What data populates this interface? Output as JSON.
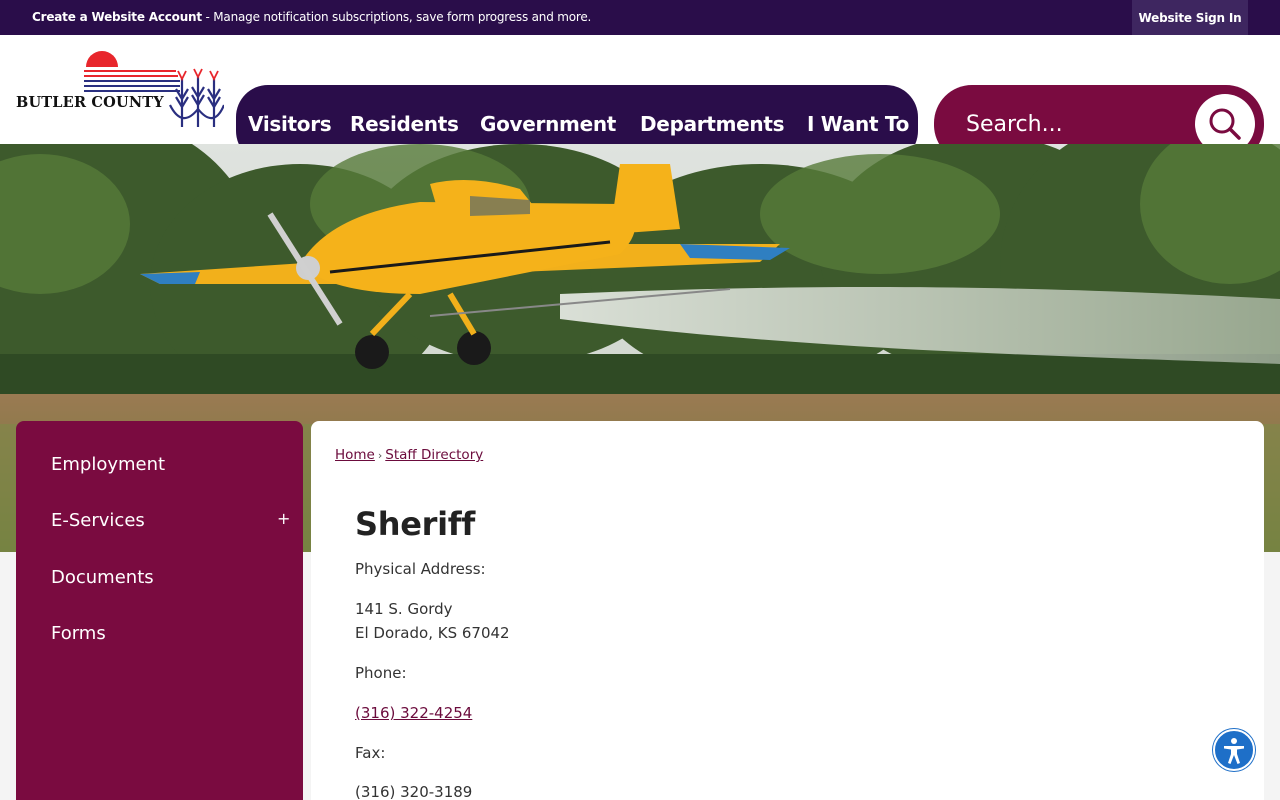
{
  "topbar": {
    "create_account": "Create a Website Account",
    "message": " - Manage notification subscriptions, save form progress and more.",
    "sign_in": "Website Sign In"
  },
  "logo": {
    "text": "BUTLER COUNTY"
  },
  "nav": {
    "items": [
      "Visitors",
      "Residents",
      "Government",
      "Departments",
      "I Want To"
    ]
  },
  "search": {
    "placeholder": "Search...",
    "icon": "search-icon"
  },
  "sidebar": {
    "items": [
      "Employment",
      "E-Services",
      "Documents",
      "Forms"
    ],
    "expand_symbol": "+"
  },
  "breadcrumb": {
    "home": "Home",
    "separator": "›",
    "current": "Staff Directory"
  },
  "content": {
    "title": "Sheriff",
    "physical_address_label": "Physical Address:",
    "address_line1": "141 S. Gordy",
    "address_line2": "El Dorado, KS 67042",
    "phone_label": "Phone:",
    "phone": "(316) 322-4254",
    "fax_label": "Fax:",
    "fax": "(316) 320-3189"
  },
  "colors": {
    "navy": "#2a0d4a",
    "maroon": "#7a0b40",
    "accessibility": "#1e6fc8"
  }
}
